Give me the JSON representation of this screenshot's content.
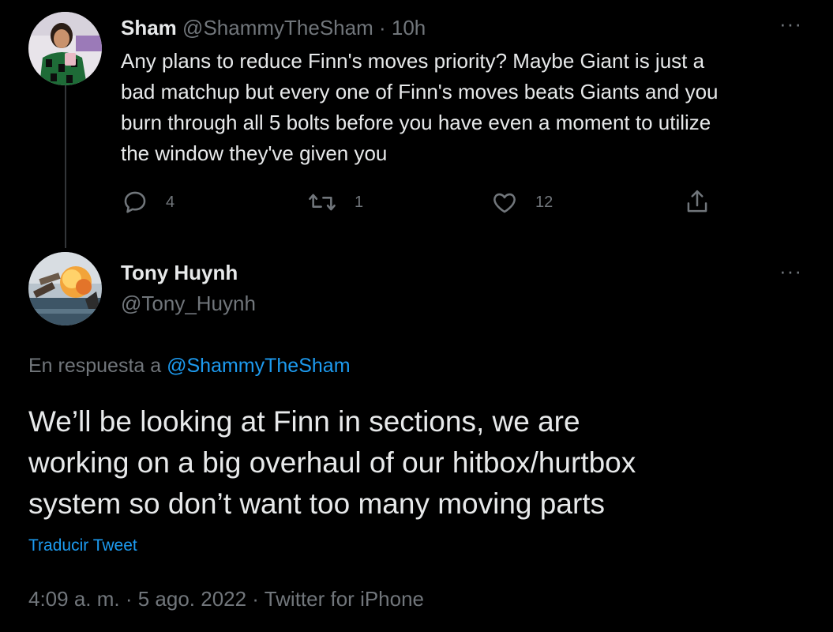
{
  "parent_tweet": {
    "display_name": "Sham",
    "handle": "@ShammyTheSham",
    "separator": "·",
    "time": "10h",
    "more_glyph": "···",
    "text": "Any plans to reduce Finn's moves priority? Maybe Giant is just a\nbad matchup but every one of Finn's moves beats Giants and you\nburn through all 5 bolts before you have even a moment to utilize\nthe window they've given you",
    "reply_count": "4",
    "retweet_count": "1",
    "like_count": "12"
  },
  "main_tweet": {
    "display_name": "Tony Huynh",
    "handle": "@Tony_Huynh",
    "more_glyph": "···",
    "reply_prefix": "En respuesta a",
    "reply_mention": "@ShammyTheSham",
    "text": "We’ll be looking at Finn in sections, we are\nworking on a big overhaul of our hitbox/hurtbox\nsystem so don’t want too many moving parts",
    "translate_label": "Traducir Tweet",
    "meta": "4:09 a. m. · 5 ago. 2022 · Twitter for iPhone"
  },
  "icons": {
    "reply": "reply-icon",
    "retweet": "retweet-icon",
    "like": "heart-icon",
    "share": "share-icon",
    "more": "more-icon"
  },
  "colors": {
    "background": "#000000",
    "text_primary": "#e7e9ea",
    "text_secondary": "#71767b",
    "link": "#1d9bf0",
    "thread_line": "#333639"
  }
}
